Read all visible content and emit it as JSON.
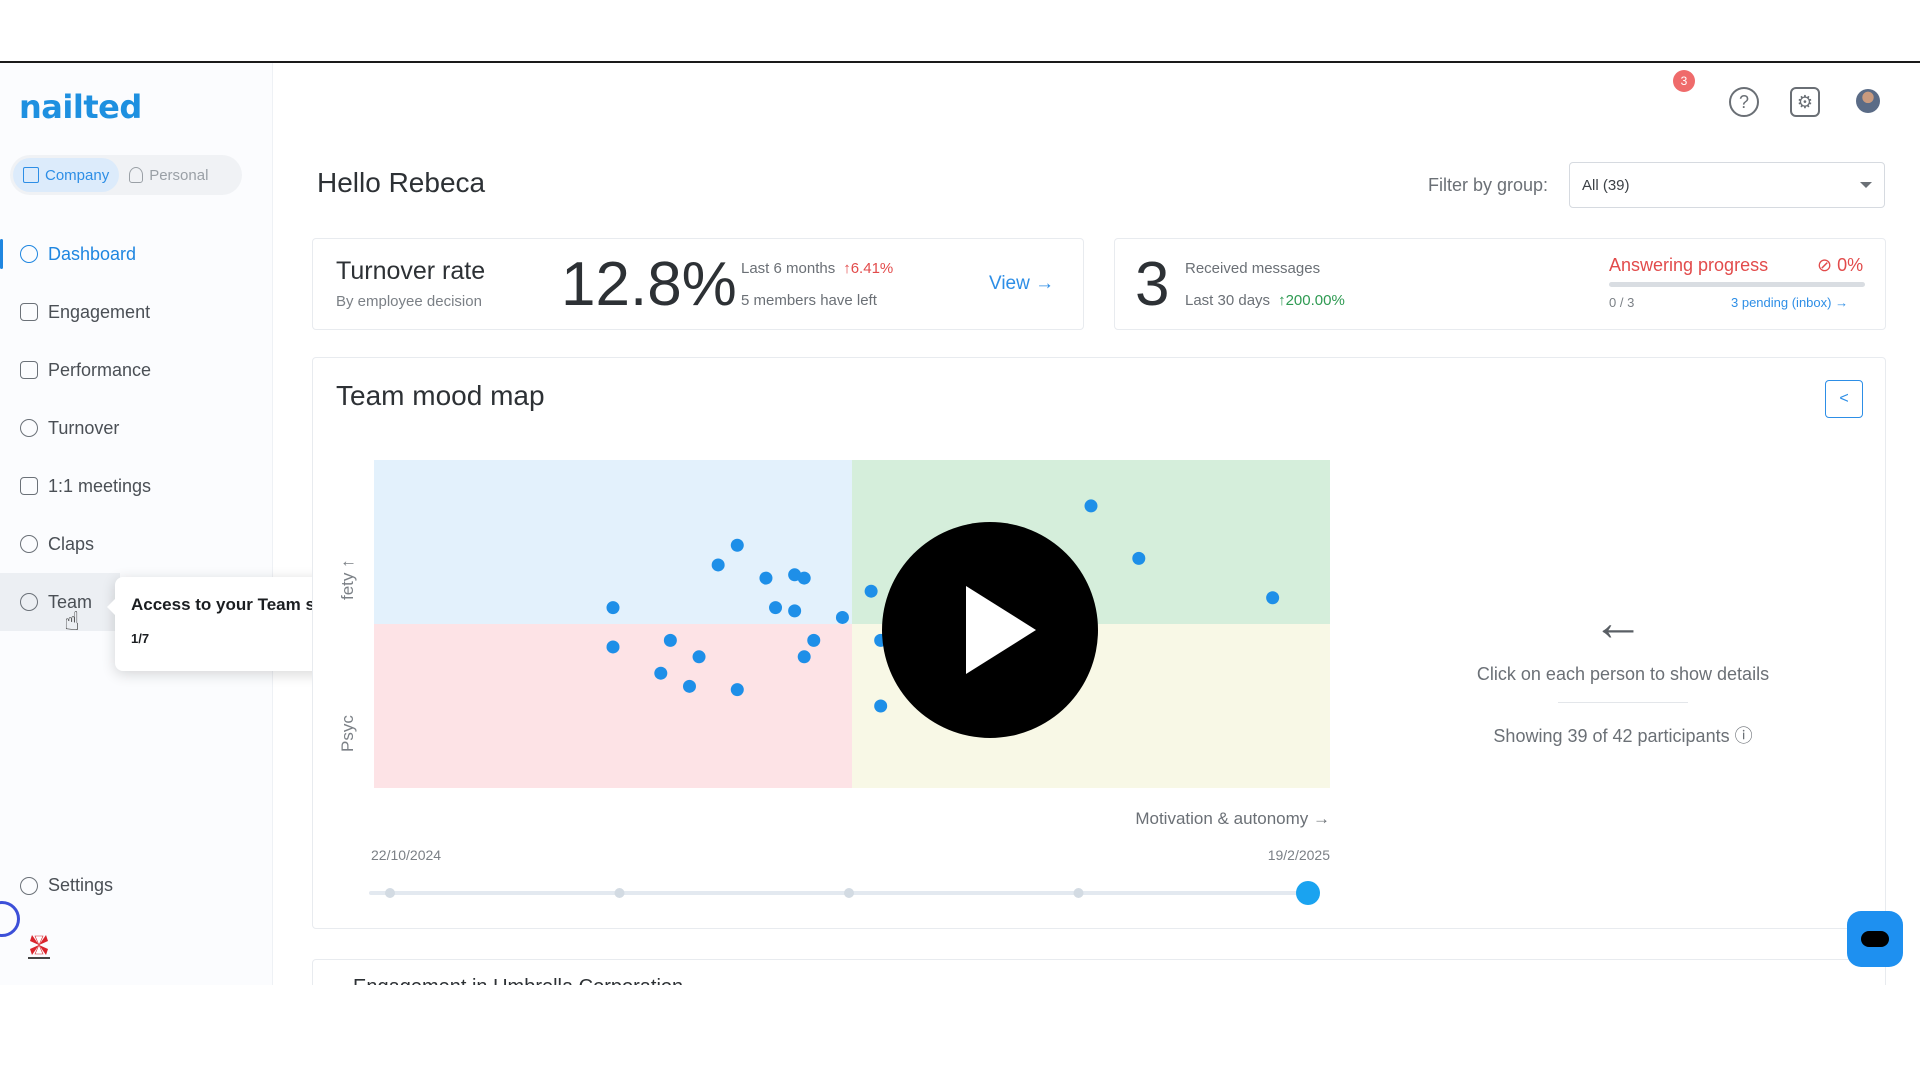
{
  "app": {
    "logo": "nailted"
  },
  "mode": {
    "company": "Company",
    "personal": "Personal"
  },
  "nav": {
    "items": [
      {
        "label": "Dashboard"
      },
      {
        "label": "Engagement"
      },
      {
        "label": "Performance"
      },
      {
        "label": "Turnover"
      },
      {
        "label": "1:1 meetings"
      },
      {
        "label": "Claps"
      },
      {
        "label": "Team"
      }
    ],
    "settings": "Settings"
  },
  "tooltip": {
    "title": "Access to your Team section",
    "step": "1/7"
  },
  "header": {
    "notifications": "3",
    "help_glyph": "?",
    "settings_glyph": "⚙",
    "greeting": "Hello Rebeca",
    "filter_label": "Filter by group:",
    "filter_value": "All (39)"
  },
  "turnover": {
    "title": "Turnover rate",
    "subtitle": "By employee decision",
    "value": "12.8%",
    "period": "Last 6 months",
    "change": "↑6.41%",
    "members_left": "5 members have left",
    "view": "View →"
  },
  "messages": {
    "count": "3",
    "label": "Received messages",
    "period": "Last 30 days",
    "change": "↑200.00%",
    "answering_label": "Answering progress",
    "answering_pct": "⊘ 0%",
    "answering_progress": 0,
    "answered": "0 / 3",
    "pending": "3 pending (inbox) →"
  },
  "mood": {
    "title": "Team mood map",
    "share_glyph": "<",
    "hint_arrow": "←",
    "hint": "Click on each person to show details",
    "showing": "Showing 39 of 42 participants ⓘ"
  },
  "chart_data": {
    "type": "scatter",
    "xlabel": "Motivation & autonomy →",
    "ylabel": "Psychological safety ↑",
    "ylabel_visible": [
      "Psyc",
      "fety ↑"
    ],
    "xlim": [
      0,
      1
    ],
    "ylim": [
      0,
      1
    ],
    "quadrant_colors": {
      "top_left": "#e3f1fc",
      "top_right": "#d5eedb",
      "bottom_left": "#fde3e6",
      "bottom_right": "#f8f8e6"
    },
    "points": [
      {
        "x": 0.25,
        "y": 0.55
      },
      {
        "x": 0.25,
        "y": 0.43
      },
      {
        "x": 0.36,
        "y": 0.68
      },
      {
        "x": 0.38,
        "y": 0.74
      },
      {
        "x": 0.41,
        "y": 0.64
      },
      {
        "x": 0.42,
        "y": 0.55
      },
      {
        "x": 0.44,
        "y": 0.65
      },
      {
        "x": 0.44,
        "y": 0.54
      },
      {
        "x": 0.45,
        "y": 0.64
      },
      {
        "x": 0.31,
        "y": 0.45
      },
      {
        "x": 0.34,
        "y": 0.4
      },
      {
        "x": 0.3,
        "y": 0.35
      },
      {
        "x": 0.33,
        "y": 0.31
      },
      {
        "x": 0.38,
        "y": 0.3
      },
      {
        "x": 0.46,
        "y": 0.45
      },
      {
        "x": 0.45,
        "y": 0.4
      },
      {
        "x": 0.49,
        "y": 0.52
      },
      {
        "x": 0.52,
        "y": 0.6
      },
      {
        "x": 0.53,
        "y": 0.45
      },
      {
        "x": 0.53,
        "y": 0.25
      },
      {
        "x": 0.75,
        "y": 0.86
      },
      {
        "x": 0.8,
        "y": 0.7
      },
      {
        "x": 0.94,
        "y": 0.58
      }
    ],
    "timeline": {
      "start": "22/10/2024",
      "end": "19/2/2025",
      "stops": 5,
      "selected": 5
    },
    "point_color": "#1e8fe8"
  },
  "next_section": {
    "title": "Engagement in Umbrella Corporation"
  }
}
